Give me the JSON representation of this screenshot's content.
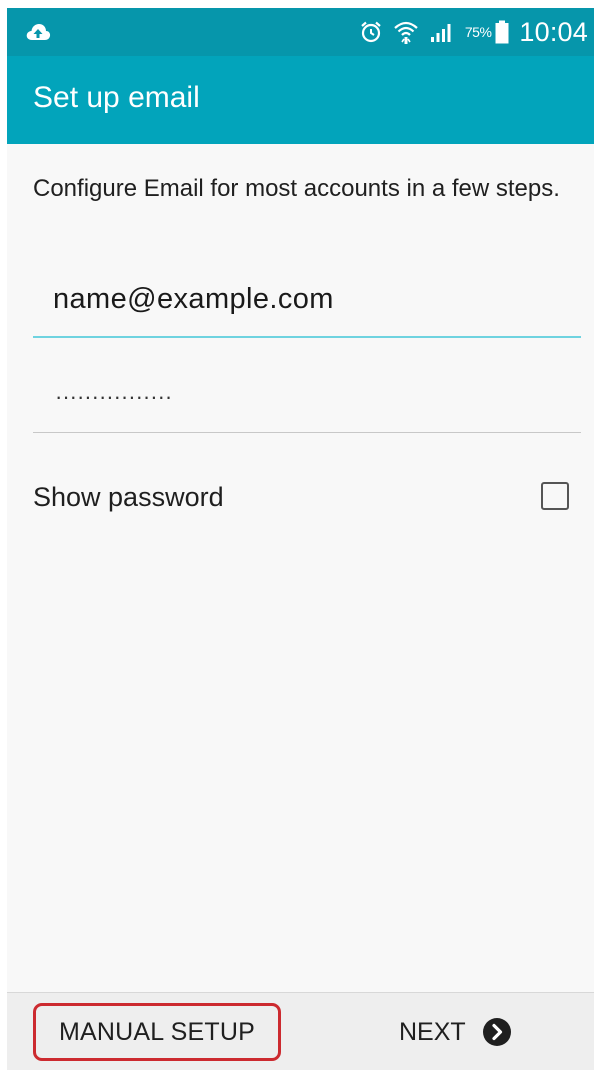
{
  "status_bar": {
    "battery_percent": "75%",
    "time": "10:04",
    "icons": [
      "cloud-upload-icon",
      "alarm-icon",
      "wifi-icon",
      "signal-icon",
      "battery-icon"
    ]
  },
  "header": {
    "title": "Set up email"
  },
  "main": {
    "intro": "Configure Email for most accounts in a few steps.",
    "email_value": "name@example.com",
    "password_value": "················",
    "show_password_label": "Show password",
    "show_password_checked": false
  },
  "footer": {
    "manual_setup_label": "MANUAL SETUP",
    "next_label": "NEXT"
  },
  "colors": {
    "status_bar": "#0696ab",
    "title_bar": "#02a4bb",
    "focus_underline": "#6fd3e0",
    "highlight": "#cc2a2f"
  }
}
